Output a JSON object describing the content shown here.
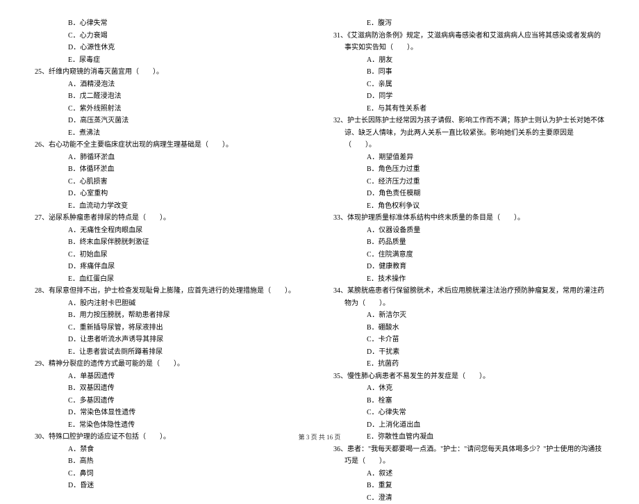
{
  "left": {
    "opts24": [
      "B．心律失常",
      "C．心力衰竭",
      "D．心源性休克",
      "E．尿毒症"
    ],
    "q25": "25、纤维内窥镜的消毒灭菌宜用（　　）。",
    "opts25": [
      "A．酒精浸泡法",
      "B．戊二醛浸泡法",
      "C．紫外线照射法",
      "D．高压蒸汽灭菌法",
      "E．煮沸法"
    ],
    "q26": "26、右心功能不全主要临床症状出现的病理生理基础是（　　）。",
    "opts26": [
      "A．肺循环淤血",
      "B．体循环淤血",
      "C．心肌损害",
      "D．心室重构",
      "E．血流动力学改变"
    ],
    "q27": "27、泌尿系肿瘤患者排尿的特点是（　　）。",
    "opts27": [
      "A．无痛性全程肉眼血尿",
      "B．终末血尿伴膀胱刺激征",
      "C．初始血尿",
      "D．疼痛伴血尿",
      "E．血红蛋白尿"
    ],
    "q28": "28、有尿意但排不出，护士检查发现耻骨上膨隆，应首先进行的处理措施是（　　）。",
    "opts28": [
      "A．股内注射卡巴胆碱",
      "B．用力按压膀胱，帮助患者排尿",
      "C．重新插导尿管，将尿液排出",
      "D．让患者听流水声诱导其排尿",
      "E．让患者尝试去厕所蹲着排尿"
    ],
    "q29": "29、精神分裂症的遗传方式最可能的是（　　）。",
    "opts29": [
      "A．单基因遗传",
      "B．双基因遗传",
      "C．多基因遗传",
      "D．常染色体显性遗传",
      "E．常染色体隐性遗传"
    ],
    "q30": "30、特殊口腔护理的适应证不包括（　　）。",
    "opts30": [
      "A．禁食",
      "B．高热",
      "C．鼻饲",
      "D．昏迷"
    ]
  },
  "right": {
    "opts30e": [
      "E．腹泻"
    ],
    "q31": "31、《艾滋病防治条例》规定，艾滋病病毒感染者和艾滋病病人应当将其感染或者发病的事实如实告知（　　）。",
    "opts31": [
      "A．朋友",
      "B．同事",
      "C．亲属",
      "D．同学",
      "E．与其有性关系者"
    ],
    "q32": "32、护士长因陈护士经常因为孩子请假、影响工作而不满；陈护士则认为护士长对她不体谅、缺乏人情味，为此两人关系一直比较紧张。影响她们关系的主要原因是（　　）。",
    "opts32": [
      "A．期望值差异",
      "B．角色压力过重",
      "C．经济压力过重",
      "D．角色责任模糊",
      "E．角色权利争议"
    ],
    "q33": "33、体现护理质量标准体系结构中终末质量的条目是（　　）。",
    "opts33": [
      "A．仪器设备质量",
      "B．药品质量",
      "C．住院满意度",
      "D．健康教育",
      "E．技术操作"
    ],
    "q34": "34、某膀胱癌患者行保留膀胱术，术后应用膀胱灌注法治疗预防肿瘤复发，常用的灌注药物为（　　）。",
    "opts34": [
      "A．新洁尔灭",
      "B．硼酸水",
      "C．卡介苗",
      "D．干扰素",
      "E．抗菌药"
    ],
    "q35": "35、慢性肺心病患者不易发生的并发症是（　　）。",
    "opts35": [
      "A．休克",
      "B．栓塞",
      "C．心律失常",
      "D．上消化道出血",
      "E．弥散性血管内凝血"
    ],
    "q36": "36、患者：\"我每天都要喝一点酒。\"护士：\"请问您每天具体喝多少？\"护士使用的沟通技巧是（　　）。",
    "opts36": [
      "A．叙述",
      "B．重复",
      "C．澄清"
    ]
  },
  "footer": "第 3 页 共 16 页"
}
